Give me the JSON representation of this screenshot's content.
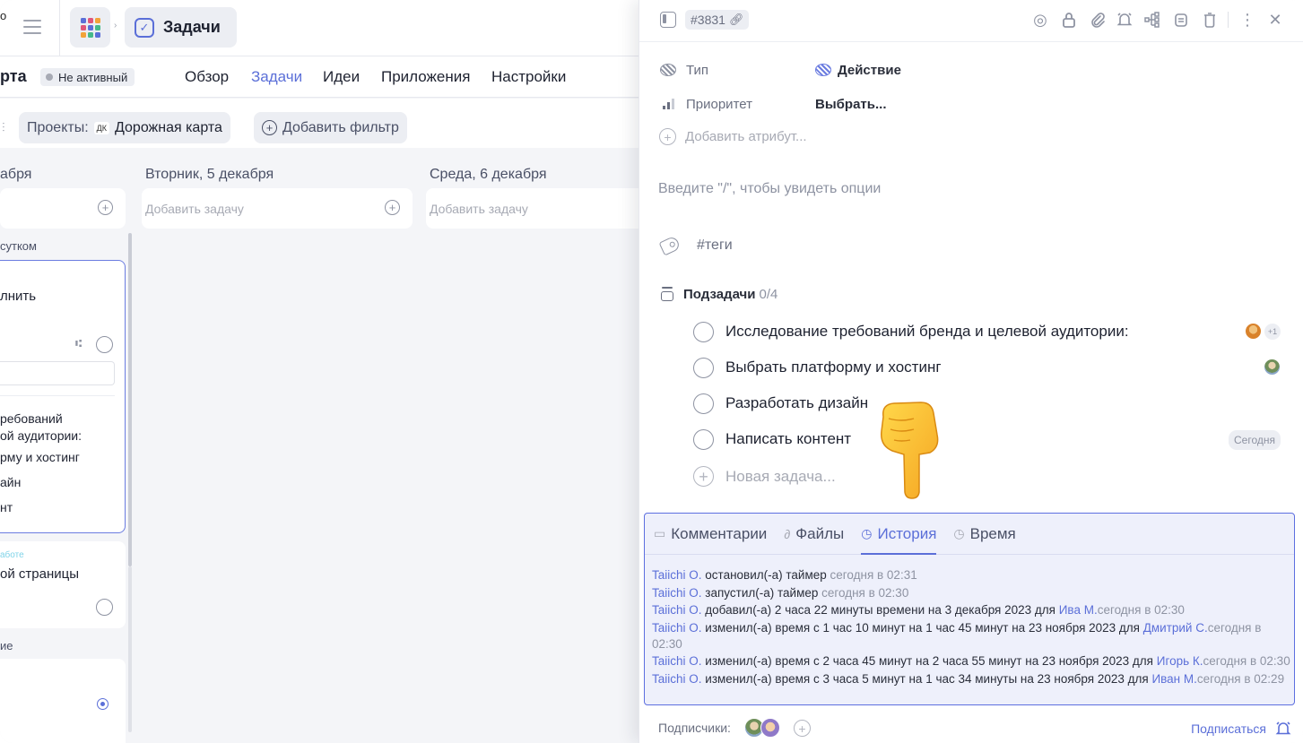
{
  "topbar": {
    "cut_text": "о",
    "breadcrumb_arrow": "›",
    "section_title": "Задачи"
  },
  "project": {
    "title_fragment": "рта",
    "status": "Не активный",
    "tabs": [
      {
        "label": "Обзор",
        "active": false
      },
      {
        "label": "Задачи",
        "active": true
      },
      {
        "label": "Идеи",
        "active": false
      },
      {
        "label": "Приложения",
        "active": false
      },
      {
        "label": "Настройки",
        "active": false
      }
    ]
  },
  "filters": {
    "project_label": "Проекты:",
    "project_badge": "ДК",
    "project_value": "Дорожная карта",
    "add_filter": "Добавить фильтр"
  },
  "board": {
    "columns": [
      {
        "title": "абря",
        "add_placeholder": ""
      },
      {
        "title": "Вторник, 5 декабря",
        "add_placeholder": "Добавить задачу"
      },
      {
        "title": "Среда, 6 декабря",
        "add_placeholder": "Добавить задачу"
      }
    ],
    "section_late": "сутком",
    "card_selected": {
      "title": "лнить",
      "lines": [
        "ребований",
        "ой аудитории:",
        "рму и хостинг",
        "айн",
        "нт"
      ]
    },
    "card2": {
      "status": "аботе",
      "title": "ой страницы"
    },
    "section_other": "ие"
  },
  "panel": {
    "task_id": "#3831",
    "attributes": [
      {
        "name": "Тип",
        "value": "Действие"
      },
      {
        "name": "Приоритет",
        "value": "Выбрать..."
      }
    ],
    "add_attribute": "Добавить атрибут...",
    "editor_placeholder": "Введите \"/\", чтобы увидеть опции",
    "tags_placeholder": "#теги",
    "subtasks_label": "Подзадачи",
    "subtasks_count": "0/4",
    "subtasks": [
      {
        "title": "Исследование требований бренда и целевой аудитории:",
        "extra": "+1"
      },
      {
        "title": "Выбрать платформу и хостинг",
        "extra": ""
      },
      {
        "title": "Разработать дизайн",
        "extra": ""
      },
      {
        "title": "Написать контент",
        "extra": "Сегодня"
      }
    ],
    "new_task": "Новая задача...",
    "activity_tabs": [
      {
        "label": "Комментарии",
        "active": false
      },
      {
        "label": "Файлы",
        "active": false
      },
      {
        "label": "История",
        "active": true
      },
      {
        "label": "Время",
        "active": false
      }
    ],
    "history": [
      {
        "user": "Taiichi O.",
        "text": " остановил(-а) таймер ",
        "target": "",
        "time": "сегодня в 02:31"
      },
      {
        "user": "Taiichi O.",
        "text": " запустил(-а) таймер ",
        "target": "",
        "time": "сегодня в 02:30"
      },
      {
        "user": "Taiichi O.",
        "text": " добавил(-а) 2 часа 22 минуты времени на 3 декабря 2023 для ",
        "target": "Ива М.",
        "time": "сегодня в 02:30"
      },
      {
        "user": "Taiichi O.",
        "text": " изменил(-а) время с 1 час 10 минут на 1 час 45 минут на 23 ноября 2023 для ",
        "target": "Дмитрий С.",
        "time": "сегодня в 02:30"
      },
      {
        "user": "Taiichi O.",
        "text": " изменил(-а) время с 2 часа 45 минут на 2 часа 55 минут на 23 ноября 2023 для ",
        "target": "Игорь К.",
        "time": "сегодня в 02:30"
      },
      {
        "user": "Taiichi O.",
        "text": " изменил(-а) время с 3 часа 5 минут на 1 час 34 минуты на 23 ноября 2023 для ",
        "target": "Иван М.",
        "time": "сегодня в 02:29"
      }
    ],
    "subscribers_label": "Подписчики:",
    "subscribe": "Подписаться"
  },
  "colors": {
    "accent": "#5b6fd8",
    "selection_border": "#5d6fe0",
    "activity_bg": "#eef0fb"
  }
}
